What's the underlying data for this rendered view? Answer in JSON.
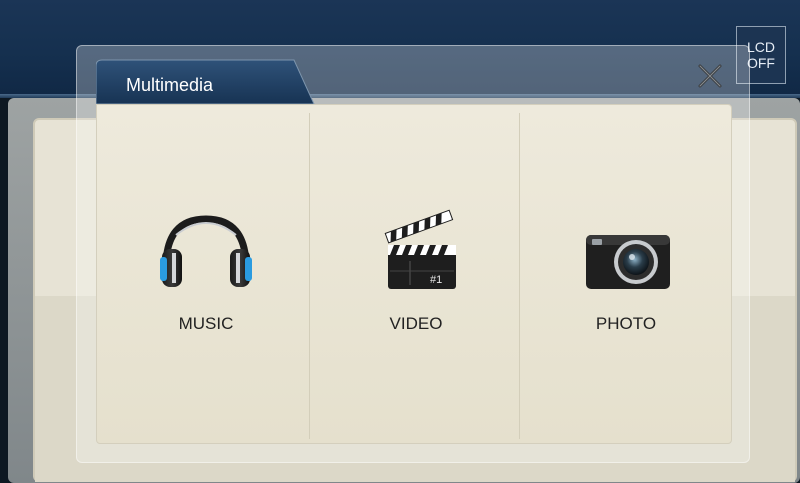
{
  "lcd_button": {
    "line1": "LCD",
    "line2": "OFF"
  },
  "dialog": {
    "tab_title": "Multimedia",
    "close_icon": "close-icon"
  },
  "tiles": [
    {
      "label": "MUSIC",
      "icon": "headphones-icon"
    },
    {
      "label": "VIDEO",
      "icon": "clapperboard-icon"
    },
    {
      "label": "PHOTO",
      "icon": "camera-icon"
    }
  ],
  "clapper_text": "#1"
}
